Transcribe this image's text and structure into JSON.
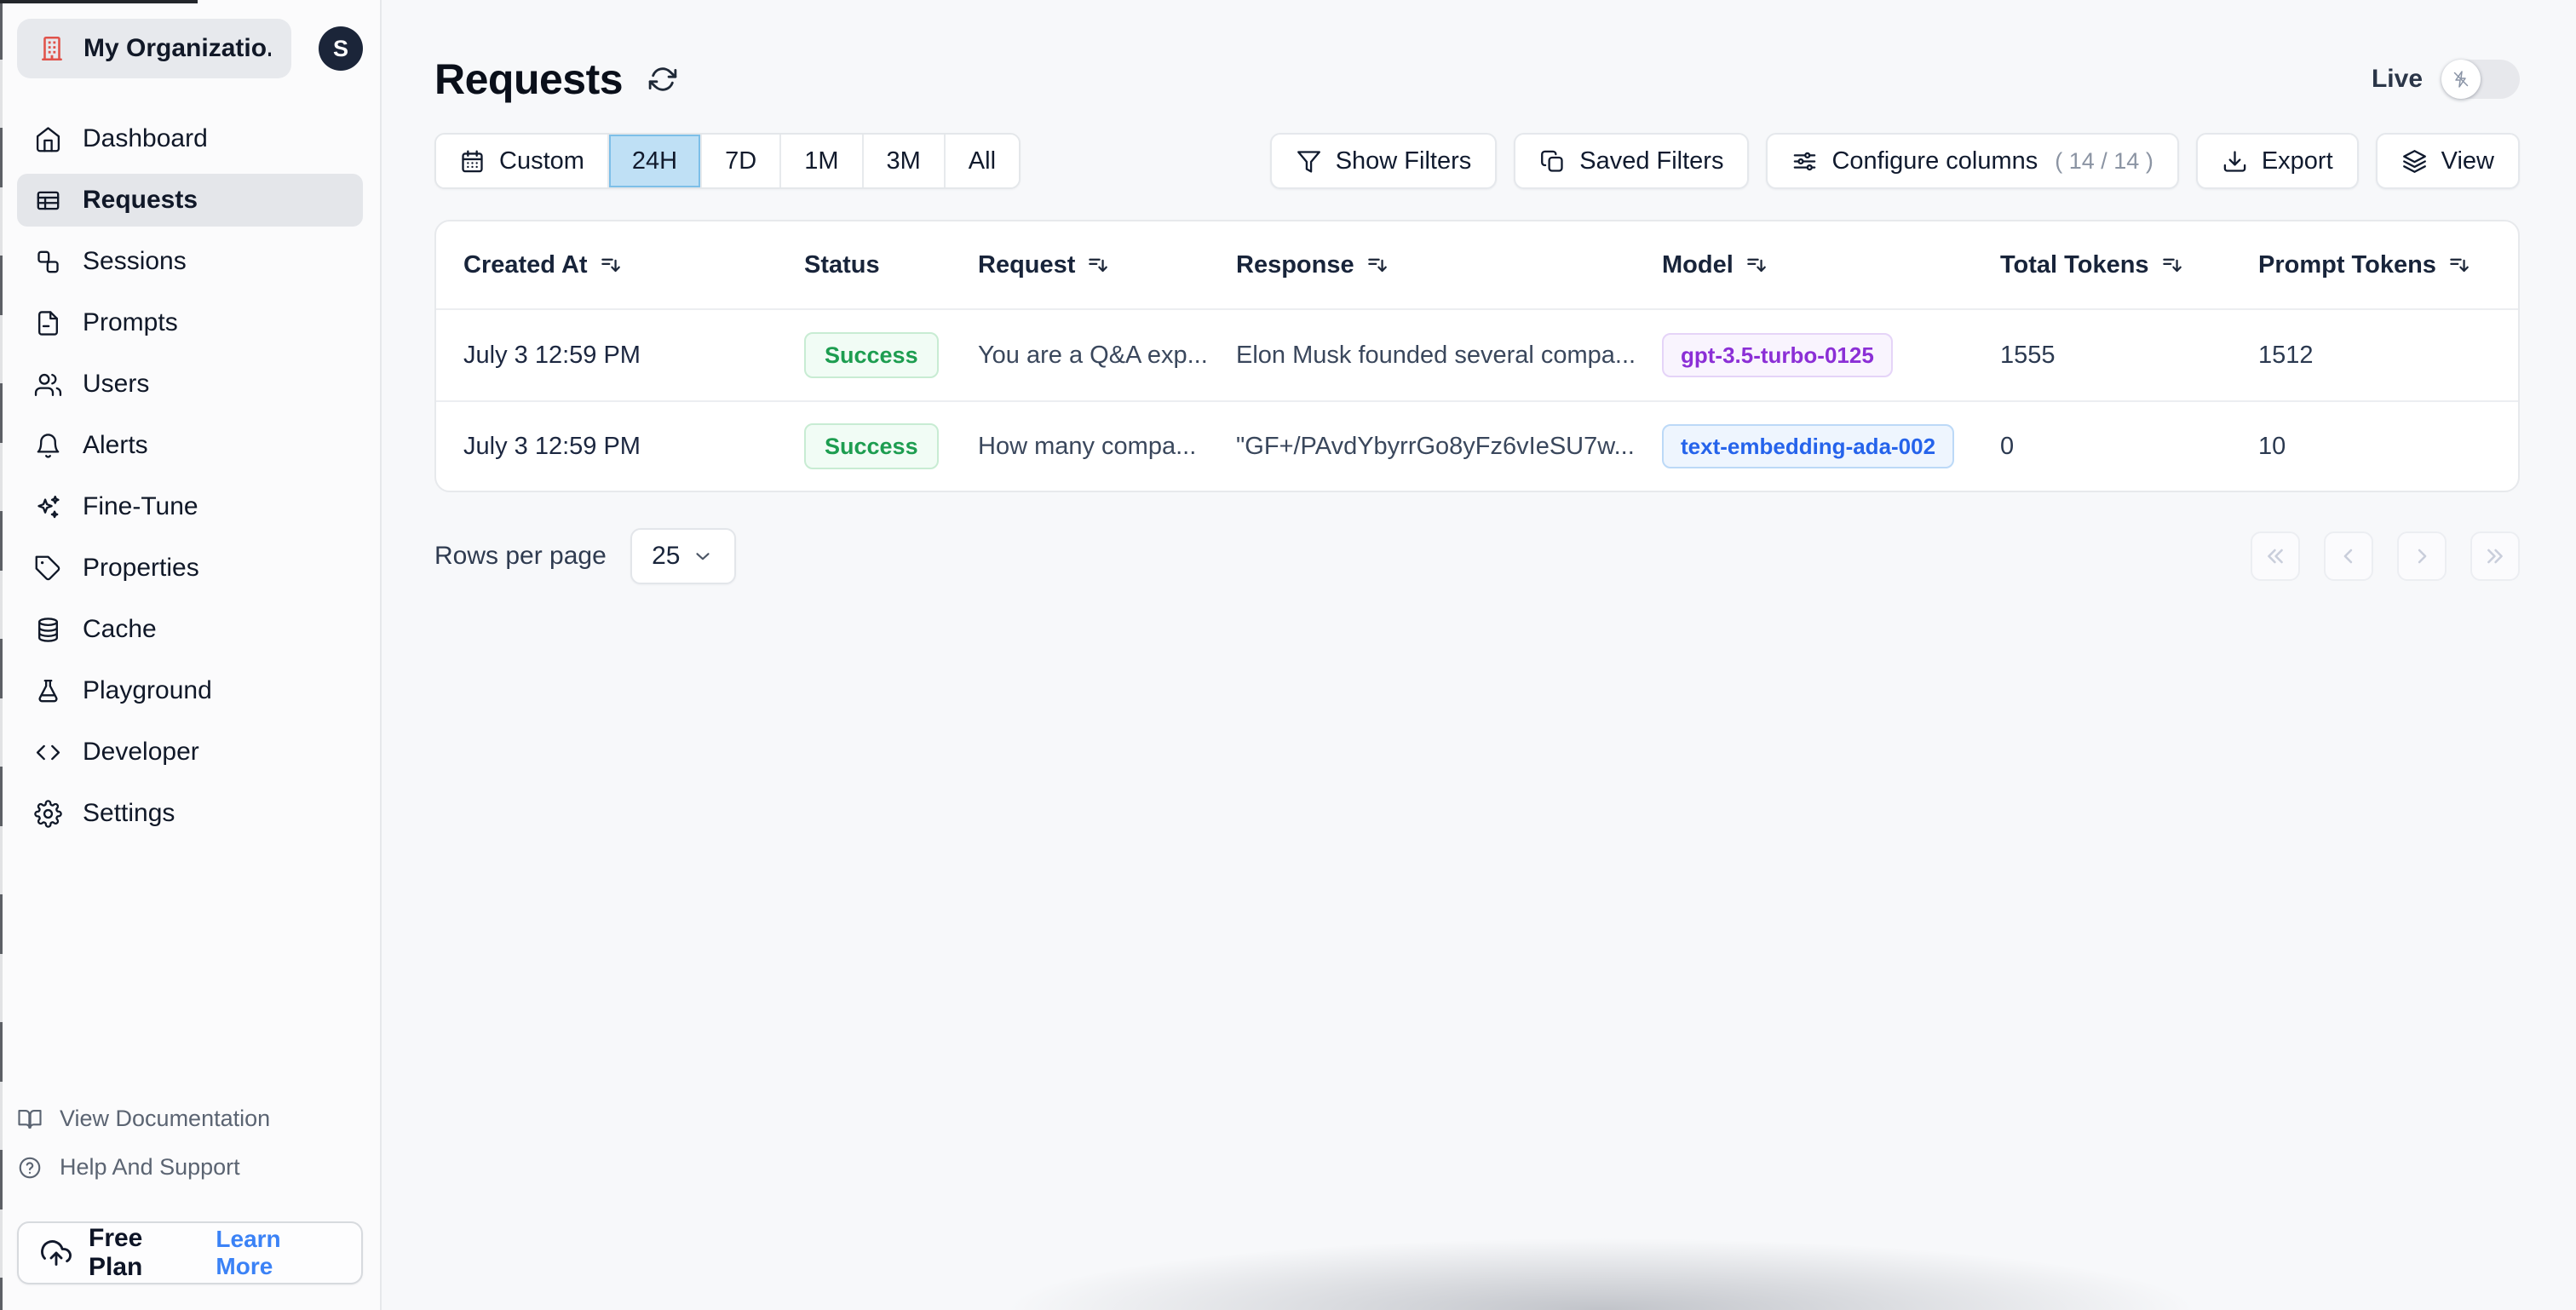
{
  "org": {
    "name": "My Organizatio...",
    "avatar_initial": "S"
  },
  "sidebar": {
    "items": [
      {
        "label": "Dashboard",
        "icon": "home-icon"
      },
      {
        "label": "Requests",
        "icon": "table-icon",
        "active": true
      },
      {
        "label": "Sessions",
        "icon": "sessions-icon"
      },
      {
        "label": "Prompts",
        "icon": "document-icon"
      },
      {
        "label": "Users",
        "icon": "users-icon"
      },
      {
        "label": "Alerts",
        "icon": "bell-icon"
      },
      {
        "label": "Fine-Tune",
        "icon": "sparkles-icon"
      },
      {
        "label": "Properties",
        "icon": "tag-icon"
      },
      {
        "label": "Cache",
        "icon": "database-icon"
      },
      {
        "label": "Playground",
        "icon": "flask-icon"
      },
      {
        "label": "Developer",
        "icon": "code-icon"
      },
      {
        "label": "Settings",
        "icon": "gear-icon"
      }
    ],
    "footer_links": [
      {
        "label": "View Documentation",
        "icon": "book-open-icon"
      },
      {
        "label": "Help And Support",
        "icon": "help-circle-icon"
      }
    ],
    "plan": {
      "label": "Free Plan",
      "cta": "Learn More"
    }
  },
  "header": {
    "title": "Requests",
    "live_label": "Live"
  },
  "filters": {
    "custom_label": "Custom",
    "ranges": [
      "24H",
      "7D",
      "1M",
      "3M",
      "All"
    ],
    "selected_range": "24H",
    "show_filters": "Show Filters",
    "saved_filters": "Saved Filters",
    "configure_columns": "Configure columns",
    "configure_columns_count": "( 14 / 14 )",
    "export_label": "Export",
    "view_label": "View"
  },
  "table": {
    "columns": [
      {
        "label": "Created At",
        "sortable": true
      },
      {
        "label": "Status",
        "sortable": false
      },
      {
        "label": "Request",
        "sortable": true
      },
      {
        "label": "Response",
        "sortable": true
      },
      {
        "label": "Model",
        "sortable": true
      },
      {
        "label": "Total Tokens",
        "sortable": true
      },
      {
        "label": "Prompt Tokens",
        "sortable": true
      }
    ],
    "rows": [
      {
        "created_at": "July 3 12:59 PM",
        "status": "Success",
        "request": "You are a Q&A exp...",
        "response": "Elon Musk founded several compa...",
        "model": "gpt-3.5-turbo-0125",
        "model_color": "purple",
        "total_tokens": "1555",
        "prompt_tokens": "1512"
      },
      {
        "created_at": "July 3 12:59 PM",
        "status": "Success",
        "request": "How many compa...",
        "response": "\"GF+/PAvdYbyrrGo8yFz6vIeSU7w...",
        "model": "text-embedding-ada-002",
        "model_color": "blue",
        "total_tokens": "0",
        "prompt_tokens": "10"
      }
    ]
  },
  "pagination": {
    "rows_per_page_label": "Rows per page",
    "rows_per_page_value": "25"
  },
  "colors": {
    "selected_range_bg": "#bfe0f5",
    "success_text": "#1d9d50",
    "model_purple": "#8b2fd6",
    "model_blue": "#2563eb",
    "link_blue": "#3b82f6",
    "org_icon_red": "#e0524a"
  }
}
